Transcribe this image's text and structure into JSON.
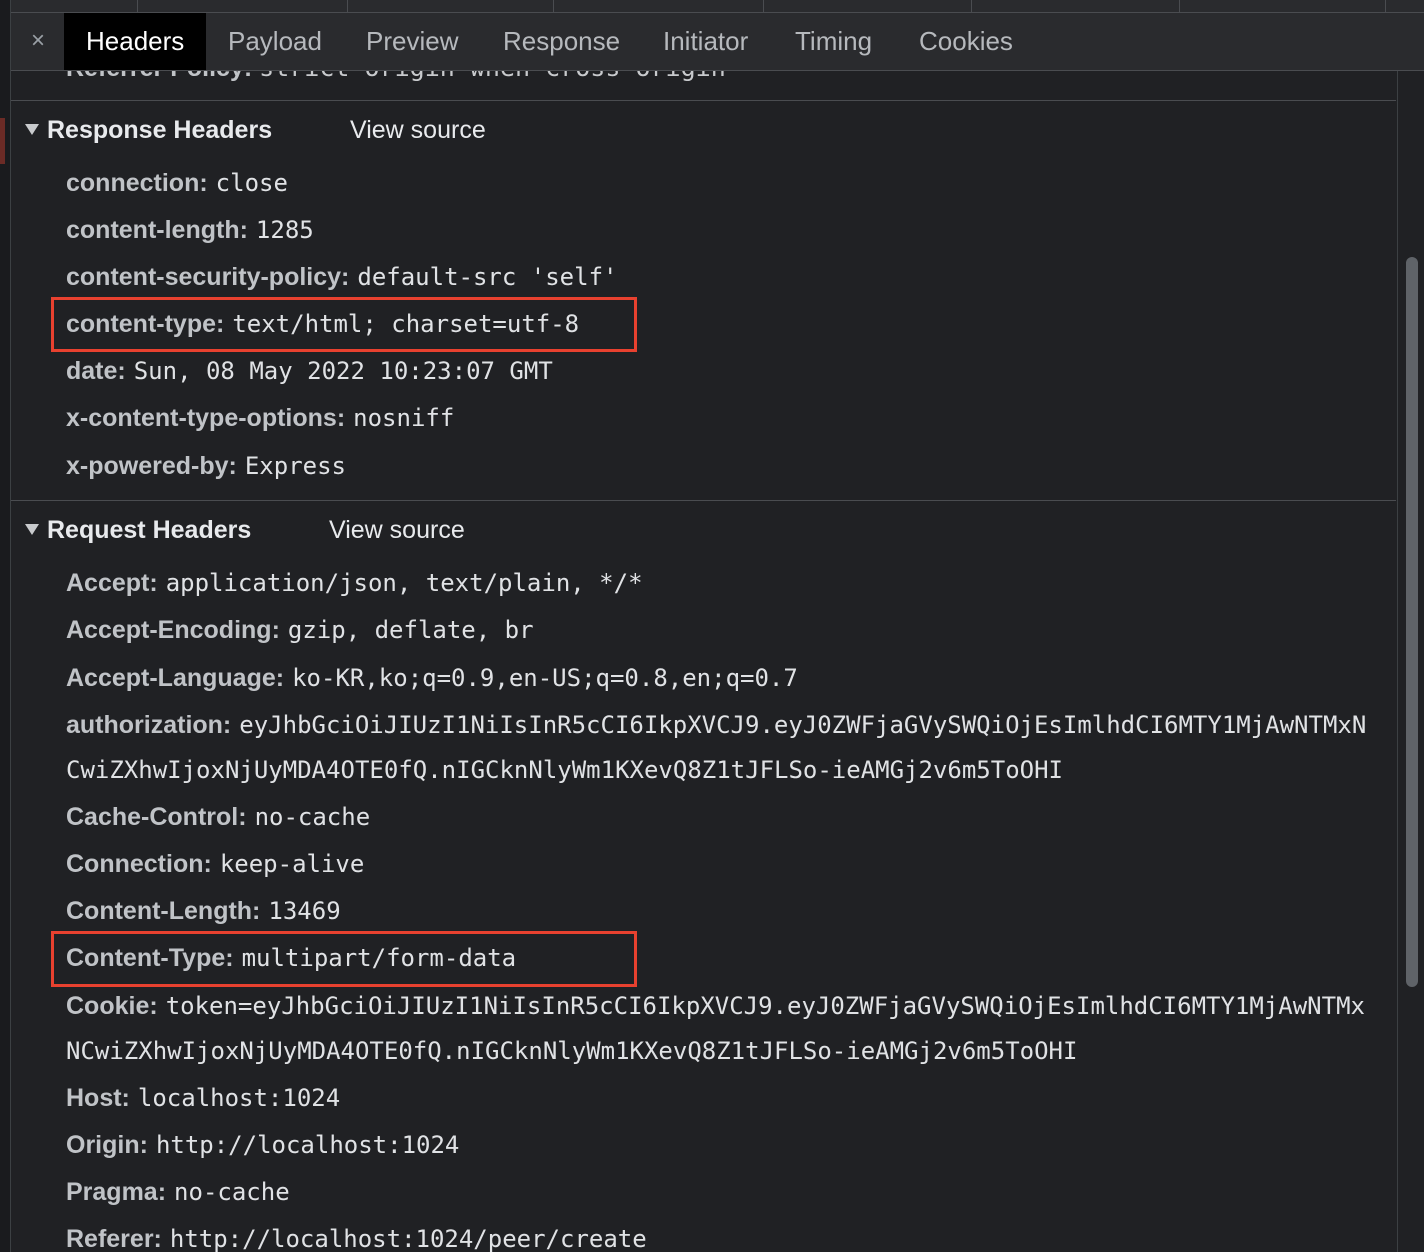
{
  "tabs": [
    {
      "id": "headers",
      "label": "Headers",
      "active": true
    },
    {
      "id": "payload",
      "label": "Payload"
    },
    {
      "id": "preview",
      "label": "Preview"
    },
    {
      "id": "response",
      "label": "Response"
    },
    {
      "id": "initiator",
      "label": "Initiator"
    },
    {
      "id": "timing",
      "label": "Timing"
    },
    {
      "id": "cookies",
      "label": "Cookies"
    }
  ],
  "close_label": "×",
  "cut_row": {
    "name": "Referrer Policy:",
    "value": "strict-origin-when-cross-origin"
  },
  "response_headers": {
    "title": "Response Headers",
    "view_source": "View source",
    "rows": [
      {
        "name": "connection:",
        "value": "close"
      },
      {
        "name": "content-length:",
        "value": "1285"
      },
      {
        "name": "content-security-policy:",
        "value": "default-src 'self'"
      },
      {
        "name": "content-type:",
        "value": "text/html; charset=utf-8",
        "highlighted": true
      },
      {
        "name": "date:",
        "value": "Sun, 08 May 2022 10:23:07 GMT"
      },
      {
        "name": "x-content-type-options:",
        "value": "nosniff"
      },
      {
        "name": "x-powered-by:",
        "value": "Express"
      }
    ]
  },
  "request_headers": {
    "title": "Request Headers",
    "view_source": "View source",
    "rows": [
      {
        "name": "Accept:",
        "value": "application/json, text/plain, */*"
      },
      {
        "name": "Accept-Encoding:",
        "value": "gzip, deflate, br"
      },
      {
        "name": "Accept-Language:",
        "value": "ko-KR,ko;q=0.9,en-US;q=0.8,en;q=0.7"
      },
      {
        "name": "authorization:",
        "value": "eyJhbGciOiJIUzI1NiIsInR5cCI6IkpXVCJ9.eyJ0ZWFjaGVySWQiOjEsImlhdCI6MTY1MjAwNTMxN",
        "continuation": "CwiZXhwIjoxNjUyMDA4OTE0fQ.nIGCknNlyWm1KXevQ8Z1tJFLSo-ieAMGj2v6m5ToOHI"
      },
      {
        "name": "Cache-Control:",
        "value": "no-cache"
      },
      {
        "name": "Connection:",
        "value": "keep-alive"
      },
      {
        "name": "Content-Length:",
        "value": "13469"
      },
      {
        "name": "Content-Type:",
        "value": "multipart/form-data",
        "highlighted": true
      },
      {
        "name": "Cookie:",
        "value": "token=eyJhbGciOiJIUzI1NiIsInR5cCI6IkpXVCJ9.eyJ0ZWFjaGVySWQiOjEsImlhdCI6MTY1MjAwNTMx",
        "continuation": "NCwiZXhwIjoxNjUyMDA4OTE0fQ.nIGCknNlyWm1KXevQ8Z1tJFLSo-ieAMGj2v6m5ToOHI"
      },
      {
        "name": "Host:",
        "value": "localhost:1024"
      },
      {
        "name": "Origin:",
        "value": "http://localhost:1024"
      },
      {
        "name": "Pragma:",
        "value": "no-cache"
      },
      {
        "name": "Referer:",
        "value": "http://localhost:1024/peer/create"
      }
    ]
  },
  "colors": {
    "background": "#202124",
    "tabbar": "#2a2b2e",
    "active_tab": "#000000",
    "highlight": "#e8412f",
    "header_name": "#c0c3c7"
  }
}
